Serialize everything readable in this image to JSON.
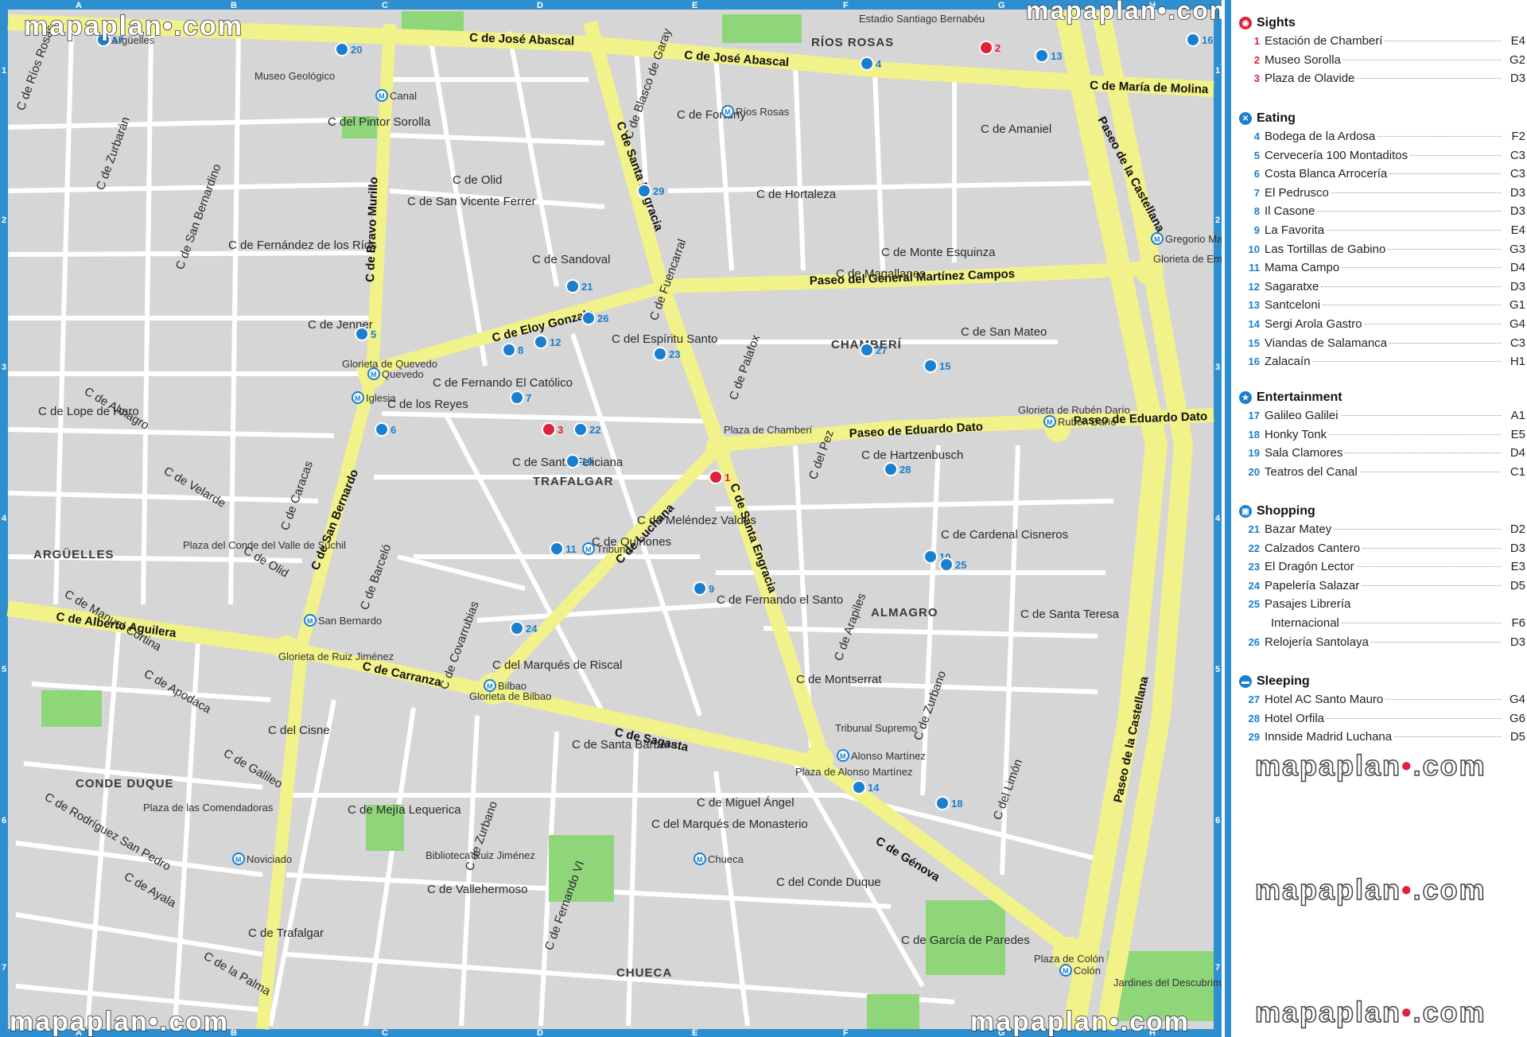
{
  "brand": {
    "text": "mapaplan",
    "tld": ".com"
  },
  "grid": {
    "letters": [
      "A",
      "B",
      "C",
      "D",
      "E",
      "F",
      "G",
      "H"
    ],
    "numbers": [
      "1",
      "2",
      "3",
      "4",
      "5",
      "6",
      "7"
    ]
  },
  "colors": {
    "street_main": "#f2f28a",
    "street_minor": "#ffffff",
    "block": "#d6d6d6",
    "park": "#8fd67a",
    "border": "#2e8fd0",
    "sights": "#e0203a",
    "eating": "#1a7fcf",
    "entertainment": "#1a7fcf",
    "shopping": "#1a7fcf",
    "sleeping": "#1a7fcf"
  },
  "map": {
    "main_streets": [
      {
        "label": "C de José Abascal"
      },
      {
        "label": "C de José Abascal"
      },
      {
        "label": "C de María de Molina"
      },
      {
        "label": "Paseo de la Castellana"
      },
      {
        "label": "Paseo de la Castellana"
      },
      {
        "label": "C de Santa Engracia"
      },
      {
        "label": "C de Santa Engracia"
      },
      {
        "label": "Paseo del General Martínez Campos"
      },
      {
        "label": "C de Eloy Gonzalo"
      },
      {
        "label": "Paseo de Eduardo Dato"
      },
      {
        "label": "Paseo de Eduardo Dato"
      },
      {
        "label": "C de Bravo Murillo"
      },
      {
        "label": "C de San Bernardo"
      },
      {
        "label": "C de Luchana"
      },
      {
        "label": "C de Alberto Aguilera"
      },
      {
        "label": "C de Carranza"
      },
      {
        "label": "C de Sagasta"
      },
      {
        "label": "C de Génova"
      }
    ],
    "districts": [
      "CHAMBERÍ",
      "TRAFALGAR",
      "ARGÜELLES",
      "ALMAGRO",
      "CONDE DUQUE",
      "CHUECA",
      "RÍOS ROSAS"
    ],
    "minor_streets": [
      "C de Ríos Rosas",
      "C de Fernández de los Ríos",
      "C de Fernando El Católico",
      "C de Meléndez Valdés",
      "C de Arapiles",
      "C de Rodríguez San Pedro",
      "C de Trafalgar",
      "C de Olid",
      "C de Fuencarral",
      "C de Hartzenbusch",
      "C de Manuel Cortina",
      "C del Cisne",
      "C de Zurbano",
      "C de Fortuny",
      "C de Monte Esquinza",
      "C de Almagro",
      "C de Caracas",
      "C del Marqués de Riscal",
      "C de Miguel Ángel",
      "C de García de Paredes",
      "C de Zurbarán",
      "C de Jenner",
      "C de Santa Feliciana",
      "C de Fernando el Santo",
      "C de Zurbano",
      "C de Ayala",
      "C del Pintor Sorolla",
      "C de Sandoval",
      "C de Palafox",
      "C de Cardenal Cisneros",
      "C de Apodaca",
      "C de Mejía Lequerica",
      "C de Fernando VI",
      "C de Hortaleza",
      "C de San Mateo",
      "C de Velarde",
      "C de Barceló",
      "C de Santa Bárbara",
      "C del Conde Duque",
      "C de Amaniel",
      "C de San Bernardino",
      "C de los Reyes",
      "C de Quiñones",
      "C de Montserrat",
      "C del Limón",
      "C de la Palma",
      "C de San Vicente Ferrer",
      "C del Espíritu Santo",
      "C del Pez",
      "C de Santa Teresa",
      "C de Galileo",
      "C de Vallehermoso",
      "C de Blasco de Garay",
      "C de Magallanes",
      "C de Lope de Haro",
      "C de Olid",
      "C de Covarrubias",
      "C del Marqués de Monasterio"
    ],
    "pois": [
      "Glorieta de Quevedo",
      "Glorieta de Bilbao",
      "Glorieta de Ruiz Jiménez",
      "Glorieta de Rubén Darío",
      "Glorieta de Emilio Castelar",
      "Plaza de Chamberí",
      "Plaza de Alonso Martínez",
      "Plaza de Colón",
      "Plaza del Conde del Valle de Súchil",
      "Jardines del Descubrimiento",
      "Plaza de las Comendadoras",
      "Biblioteca Ruiz Jiménez",
      "Museo Geológico",
      "Estadio Santiago Bernabéu",
      "Tribunal Supremo"
    ],
    "metro": [
      "Iglesia",
      "Quevedo",
      "Canal",
      "Ríos Rosas",
      "Bilbao",
      "Tribunal",
      "Alonso Martínez",
      "Colón",
      "San Bernardo",
      "Rubén Darío",
      "Gregorio Marañón",
      "Argüelles",
      "Noviciado",
      "Chueca"
    ]
  },
  "legend": {
    "sights": {
      "title": "Sights",
      "items": [
        {
          "num": "1",
          "name": "Estación de Chamberí",
          "grid": "E4"
        },
        {
          "num": "2",
          "name": "Museo Sorolla",
          "grid": "G2"
        },
        {
          "num": "3",
          "name": "Plaza de Olavide",
          "grid": "D3"
        }
      ]
    },
    "eating": {
      "title": "Eating",
      "items": [
        {
          "num": "4",
          "name": "Bodega de la Ardosa",
          "grid": "F2"
        },
        {
          "num": "5",
          "name": "Cervecería 100 Montaditos",
          "grid": "C3"
        },
        {
          "num": "6",
          "name": "Costa Blanca Arrocería",
          "grid": "C3"
        },
        {
          "num": "7",
          "name": "El Pedrusco",
          "grid": "D3"
        },
        {
          "num": "8",
          "name": "Il Casone",
          "grid": "D3"
        },
        {
          "num": "9",
          "name": "La Favorita",
          "grid": "E4"
        },
        {
          "num": "10",
          "name": "Las Tortillas de Gabino",
          "grid": "G3"
        },
        {
          "num": "11",
          "name": "Mama Campo",
          "grid": "D4"
        },
        {
          "num": "12",
          "name": "Sagaratxe",
          "grid": "D3"
        },
        {
          "num": "13",
          "name": "Santceloni",
          "grid": "G1"
        },
        {
          "num": "14",
          "name": "Sergi Arola Gastro",
          "grid": "G4"
        },
        {
          "num": "15",
          "name": "Viandas de Salamanca",
          "grid": "C3"
        },
        {
          "num": "16",
          "name": "Zalacaín",
          "grid": "H1"
        }
      ]
    },
    "entertainment": {
      "title": "Entertainment",
      "items": [
        {
          "num": "17",
          "name": "Galileo Galilei",
          "grid": "A1"
        },
        {
          "num": "18",
          "name": "Honky Tonk",
          "grid": "E5"
        },
        {
          "num": "19",
          "name": "Sala Clamores",
          "grid": "D4"
        },
        {
          "num": "20",
          "name": "Teatros del Canal",
          "grid": "C1"
        }
      ]
    },
    "shopping": {
      "title": "Shopping",
      "items": [
        {
          "num": "21",
          "name": "Bazar Matey",
          "grid": "D2"
        },
        {
          "num": "22",
          "name": "Calzados Cantero",
          "grid": "D3"
        },
        {
          "num": "23",
          "name": "El Dragón Lector",
          "grid": "E3"
        },
        {
          "num": "24",
          "name": "Papelería Salazar",
          "grid": "D5"
        },
        {
          "num": "25",
          "name": "Pasajes Librería",
          "name2": "Internacional",
          "grid": "F6"
        },
        {
          "num": "26",
          "name": "Relojería Santolaya",
          "grid": "D3"
        }
      ]
    },
    "sleeping": {
      "title": "Sleeping",
      "items": [
        {
          "num": "27",
          "name": "Hotel AC Santo Mauro",
          "grid": "G4"
        },
        {
          "num": "28",
          "name": "Hotel Orfila",
          "grid": "G6"
        },
        {
          "num": "29",
          "name": "Innside Madrid Luchana",
          "grid": "D5"
        }
      ]
    }
  }
}
